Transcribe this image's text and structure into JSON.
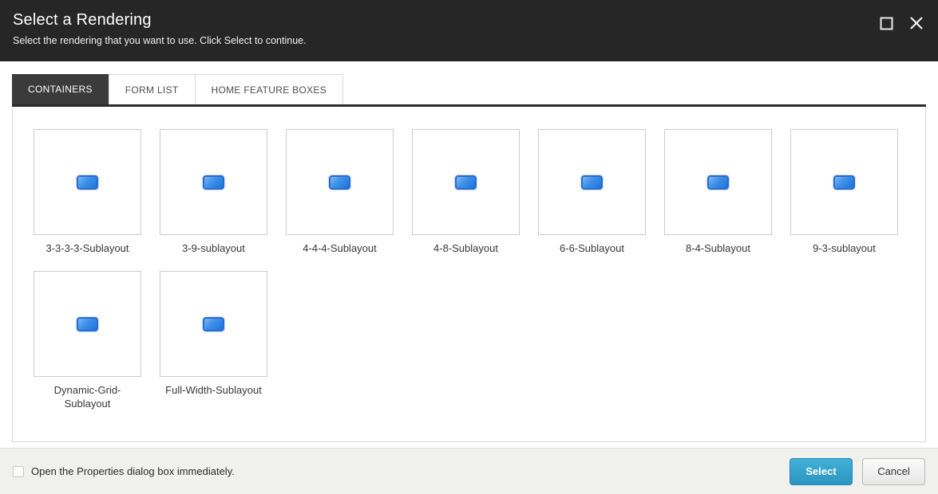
{
  "header": {
    "title": "Select a Rendering",
    "subtitle": "Select the rendering that you want to use. Click Select to continue."
  },
  "window_controls": {
    "maximize_icon": "maximize-square",
    "close_icon": "close-x"
  },
  "tabs": [
    {
      "label": "CONTAINERS",
      "active": true
    },
    {
      "label": "FORM LIST",
      "active": false
    },
    {
      "label": "HOME FEATURE BOXES",
      "active": false
    }
  ],
  "renderings": [
    "3-3-3-3-Sublayout",
    "3-9-sublayout",
    "4-4-4-Sublayout",
    "4-8-Sublayout",
    "6-6-Sublayout",
    "8-4-Sublayout",
    "9-3-sublayout",
    "Dynamic-Grid-Sublayout",
    "Full-Width-Sublayout"
  ],
  "rendering_icon": "sublayout-blue-block",
  "footer": {
    "checkbox_label": "Open the Properties dialog box immediately.",
    "checkbox_checked": false,
    "select_label": "Select",
    "cancel_label": "Cancel"
  },
  "colors": {
    "header_bg": "#262626",
    "active_tab_bg": "#3b3b3b",
    "accent_blue_button": "#2f9ac6",
    "icon_blue": "#2a6bcc",
    "footer_bg": "#f0f0ee"
  }
}
